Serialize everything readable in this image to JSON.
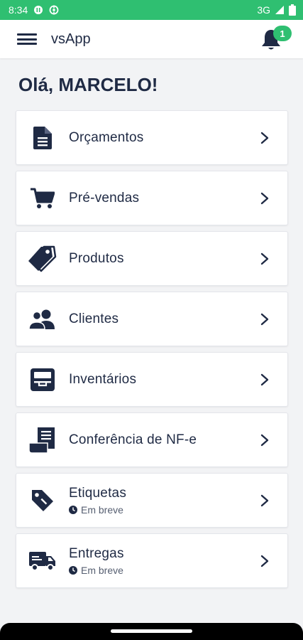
{
  "status_bar": {
    "time": "8:34",
    "network": "3G"
  },
  "app_bar": {
    "title": "vsApp",
    "notification_count": "1"
  },
  "greeting": "Olá, MARCELO!",
  "menu": [
    {
      "label": "Orçamentos",
      "icon": "document-icon"
    },
    {
      "label": "Pré-vendas",
      "icon": "cart-icon"
    },
    {
      "label": "Produtos",
      "icon": "tags-icon"
    },
    {
      "label": "Clientes",
      "icon": "users-icon"
    },
    {
      "label": "Inventários",
      "icon": "inbox-icon"
    },
    {
      "label": "Conferência de NF-e",
      "icon": "receipt-icon"
    },
    {
      "label": "Etiquetas",
      "icon": "tag-icon",
      "sub": "Em breve"
    },
    {
      "label": "Entregas",
      "icon": "truck-icon",
      "sub": "Em breve"
    }
  ],
  "colors": {
    "accent": "#2fbf71",
    "text": "#1f2a44",
    "background": "#f2f3f5"
  }
}
